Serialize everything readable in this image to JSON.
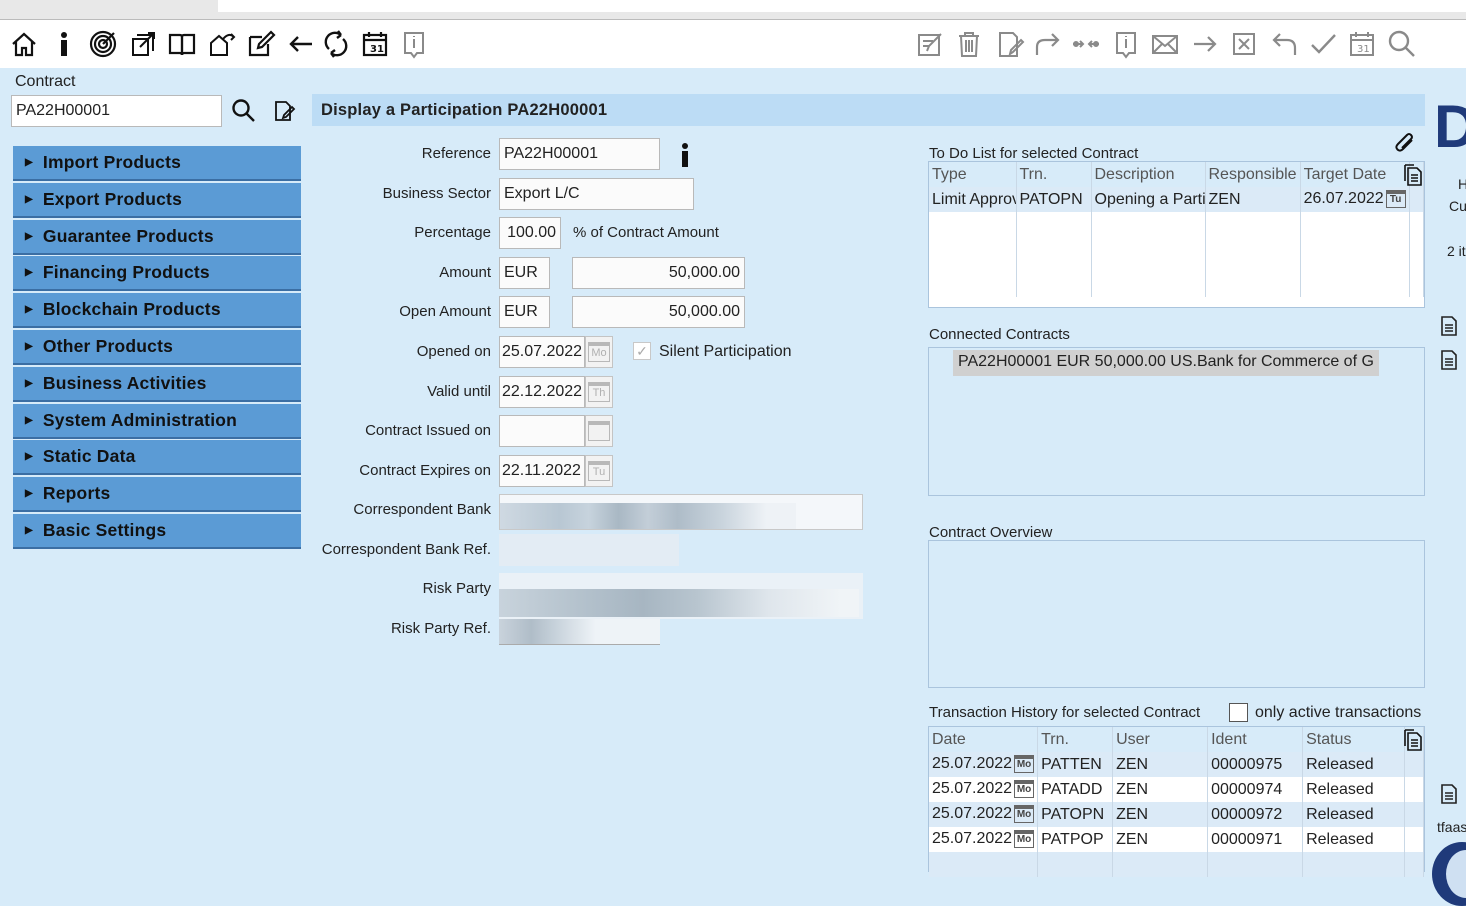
{
  "toolbar": {
    "left_icons": [
      "home-icon",
      "info-icon",
      "target-icon",
      "export-icon",
      "book-icon",
      "transfer-icon",
      "edit-icon",
      "back-arrow-icon",
      "refresh-icon",
      "calendar-icon",
      "info-box-icon"
    ],
    "right_icons": [
      "edit-form-icon",
      "trash-icon",
      "document-edit-icon",
      "redo-icon",
      "swap-icon",
      "info-box-icon",
      "mail-icon",
      "arrow-right-icon",
      "close-box-icon",
      "undo-icon",
      "check-icon",
      "calendar-icon",
      "search-icon"
    ]
  },
  "contract_search": {
    "label": "Contract",
    "value": "PA22H00001"
  },
  "sidebar": {
    "items": [
      {
        "label": "Import Products"
      },
      {
        "label": "Export Products"
      },
      {
        "label": "Guarantee Products"
      },
      {
        "label": "Financing Products"
      },
      {
        "label": "Blockchain Products"
      },
      {
        "label": "Other Products"
      },
      {
        "label": "Business Activities"
      },
      {
        "label": "System Administration"
      },
      {
        "label": "Static Data"
      },
      {
        "label": "Reports"
      },
      {
        "label": "Basic Settings"
      }
    ]
  },
  "page_title": "Display a Participation PA22H00001",
  "form": {
    "reference_label": "Reference",
    "reference": "PA22H00001",
    "business_sector_label": "Business Sector",
    "business_sector": "Export L/C",
    "percentage_label": "Percentage",
    "percentage": "100.00",
    "percentage_suffix": "% of Contract Amount",
    "amount_label": "Amount",
    "amount_ccy": "EUR",
    "amount": "50,000.00",
    "open_amount_label": "Open Amount",
    "open_amount_ccy": "EUR",
    "open_amount": "50,000.00",
    "opened_on_label": "Opened on",
    "opened_on": "25.07.2022",
    "opened_on_day": "Mo",
    "silent_label": "Silent Participation",
    "silent_checked": true,
    "valid_until_label": "Valid until",
    "valid_until": "22.12.2022",
    "valid_until_day": "Th",
    "issued_on_label": "Contract Issued on",
    "issued_on": "",
    "expires_on_label": "Contract Expires on",
    "expires_on": "22.11.2022",
    "expires_on_day": "Tu",
    "corr_bank_label": "Correspondent Bank",
    "corr_bank_ref_label": "Correspondent Bank Ref.",
    "risk_party_label": "Risk Party",
    "risk_party_ref_label": "Risk Party Ref."
  },
  "todo": {
    "title": "To Do List for selected Contract",
    "columns": [
      "Type",
      "Trn.",
      "Description",
      "Responsible",
      "Target Date"
    ],
    "rows": [
      {
        "type": "Limit Approv",
        "trn": "PATOPN",
        "description": "Opening a Partic",
        "responsible": "ZEN",
        "target_date": "26.07.2022",
        "day": "Tu"
      }
    ]
  },
  "connected": {
    "title": "Connected Contracts",
    "items": [
      "PA22H00001 EUR 50,000.00 US.Bank for Commerce of G"
    ]
  },
  "overview": {
    "title": "Contract Overview"
  },
  "history": {
    "title": "Transaction History for selected Contract",
    "only_active_label": "only active transactions",
    "only_active_checked": false,
    "columns": [
      "Date",
      "Trn.",
      "User",
      "Ident",
      "Status"
    ],
    "rows": [
      {
        "date": "25.07.2022",
        "day": "Mo",
        "trn": "PATTEN",
        "user": "ZEN",
        "ident": "00000975",
        "status": "Released"
      },
      {
        "date": "25.07.2022",
        "day": "Mo",
        "trn": "PATADD",
        "user": "ZEN",
        "ident": "00000974",
        "status": "Released"
      },
      {
        "date": "25.07.2022",
        "day": "Mo",
        "trn": "PATOPN",
        "user": "ZEN",
        "ident": "00000972",
        "status": "Released"
      },
      {
        "date": "25.07.2022",
        "day": "Mo",
        "trn": "PATPOP",
        "user": "ZEN",
        "ident": "00000971",
        "status": "Released"
      }
    ]
  },
  "right_edge": {
    "big_letter": "D",
    "snippets": [
      "H",
      "Cu",
      "2 it",
      "tfaas"
    ]
  }
}
